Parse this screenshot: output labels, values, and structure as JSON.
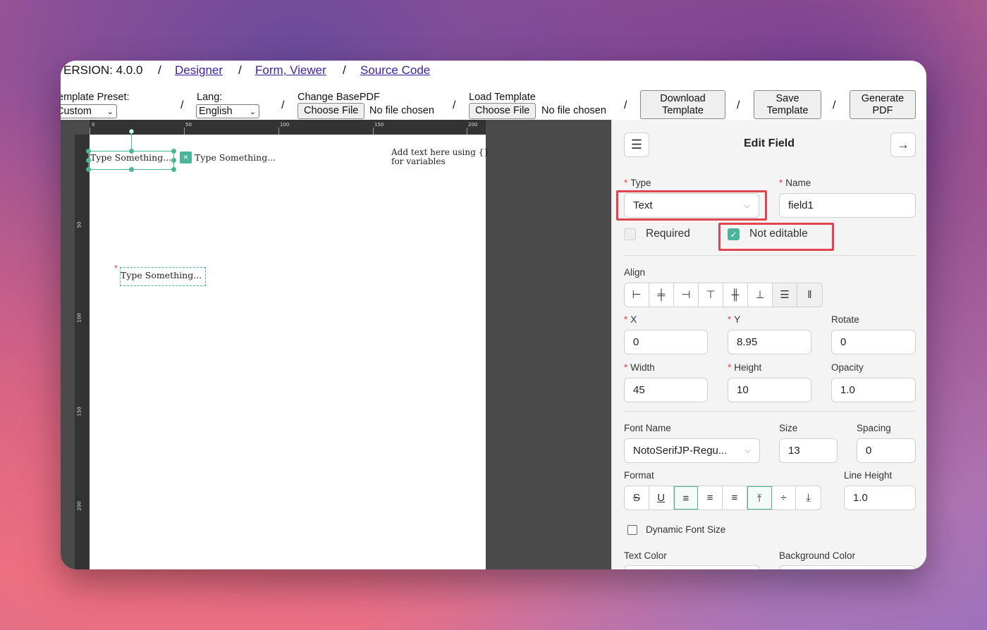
{
  "nav": {
    "version": "ERSION: 4.0.0",
    "sep": "/",
    "links": [
      "Designer",
      "Form, Viewer",
      "Source Code"
    ]
  },
  "toolbar": {
    "template_preset_label": "emplate Preset:",
    "template_preset_value": "Custom",
    "lang_label": "Lang:",
    "lang_value": "English",
    "change_basepdf_label": "Change BasePDF",
    "load_template_label": "Load Template",
    "choose_file": "Choose File",
    "no_file": "No file chosen",
    "download_template": "Download Template",
    "save_template": "Save Template",
    "generate_pdf": "Generate PDF",
    "sep": "/"
  },
  "ruler": {
    "top_ticks": [
      "0",
      "50",
      "100",
      "150",
      "200"
    ],
    "left_ticks": [
      "50",
      "100",
      "150",
      "200"
    ]
  },
  "canvas": {
    "field1_text": "Type Something...",
    "field2_text": "Type Something...",
    "field3_text": "Type Something...",
    "placeholder_line1": "Add text here using {}",
    "placeholder_line2": "for variables",
    "required_marker": "*",
    "remove_icon": "×"
  },
  "panel": {
    "title": "Edit Field",
    "menu_icon": "☰",
    "arrow_icon": "→",
    "type_label": "Type",
    "type_value": "Text",
    "name_label": "Name",
    "name_value": "field1",
    "required_label": "Required",
    "not_editable_label": "Not editable",
    "align_label": "Align",
    "x_label": "X",
    "x_value": "0",
    "y_label": "Y",
    "y_value": "8.95",
    "rotate_label": "Rotate",
    "rotate_value": "0",
    "width_label": "Width",
    "width_value": "45",
    "height_label": "Height",
    "height_value": "10",
    "opacity_label": "Opacity",
    "opacity_value": "1.0",
    "font_name_label": "Font Name",
    "font_name_value": "NotoSerifJP-Regu...",
    "size_label": "Size",
    "size_value": "13",
    "spacing_label": "Spacing",
    "spacing_value": "0",
    "format_label": "Format",
    "line_height_label": "Line Height",
    "line_height_value": "1.0",
    "dynamic_font_label": "Dynamic Font Size",
    "text_color_label": "Text Color",
    "bg_color_label": "Background Color",
    "required_star": "*"
  },
  "colors": {
    "accent": "#4bb59a",
    "highlight": "#e0454f",
    "link": "#3b1f9c"
  }
}
